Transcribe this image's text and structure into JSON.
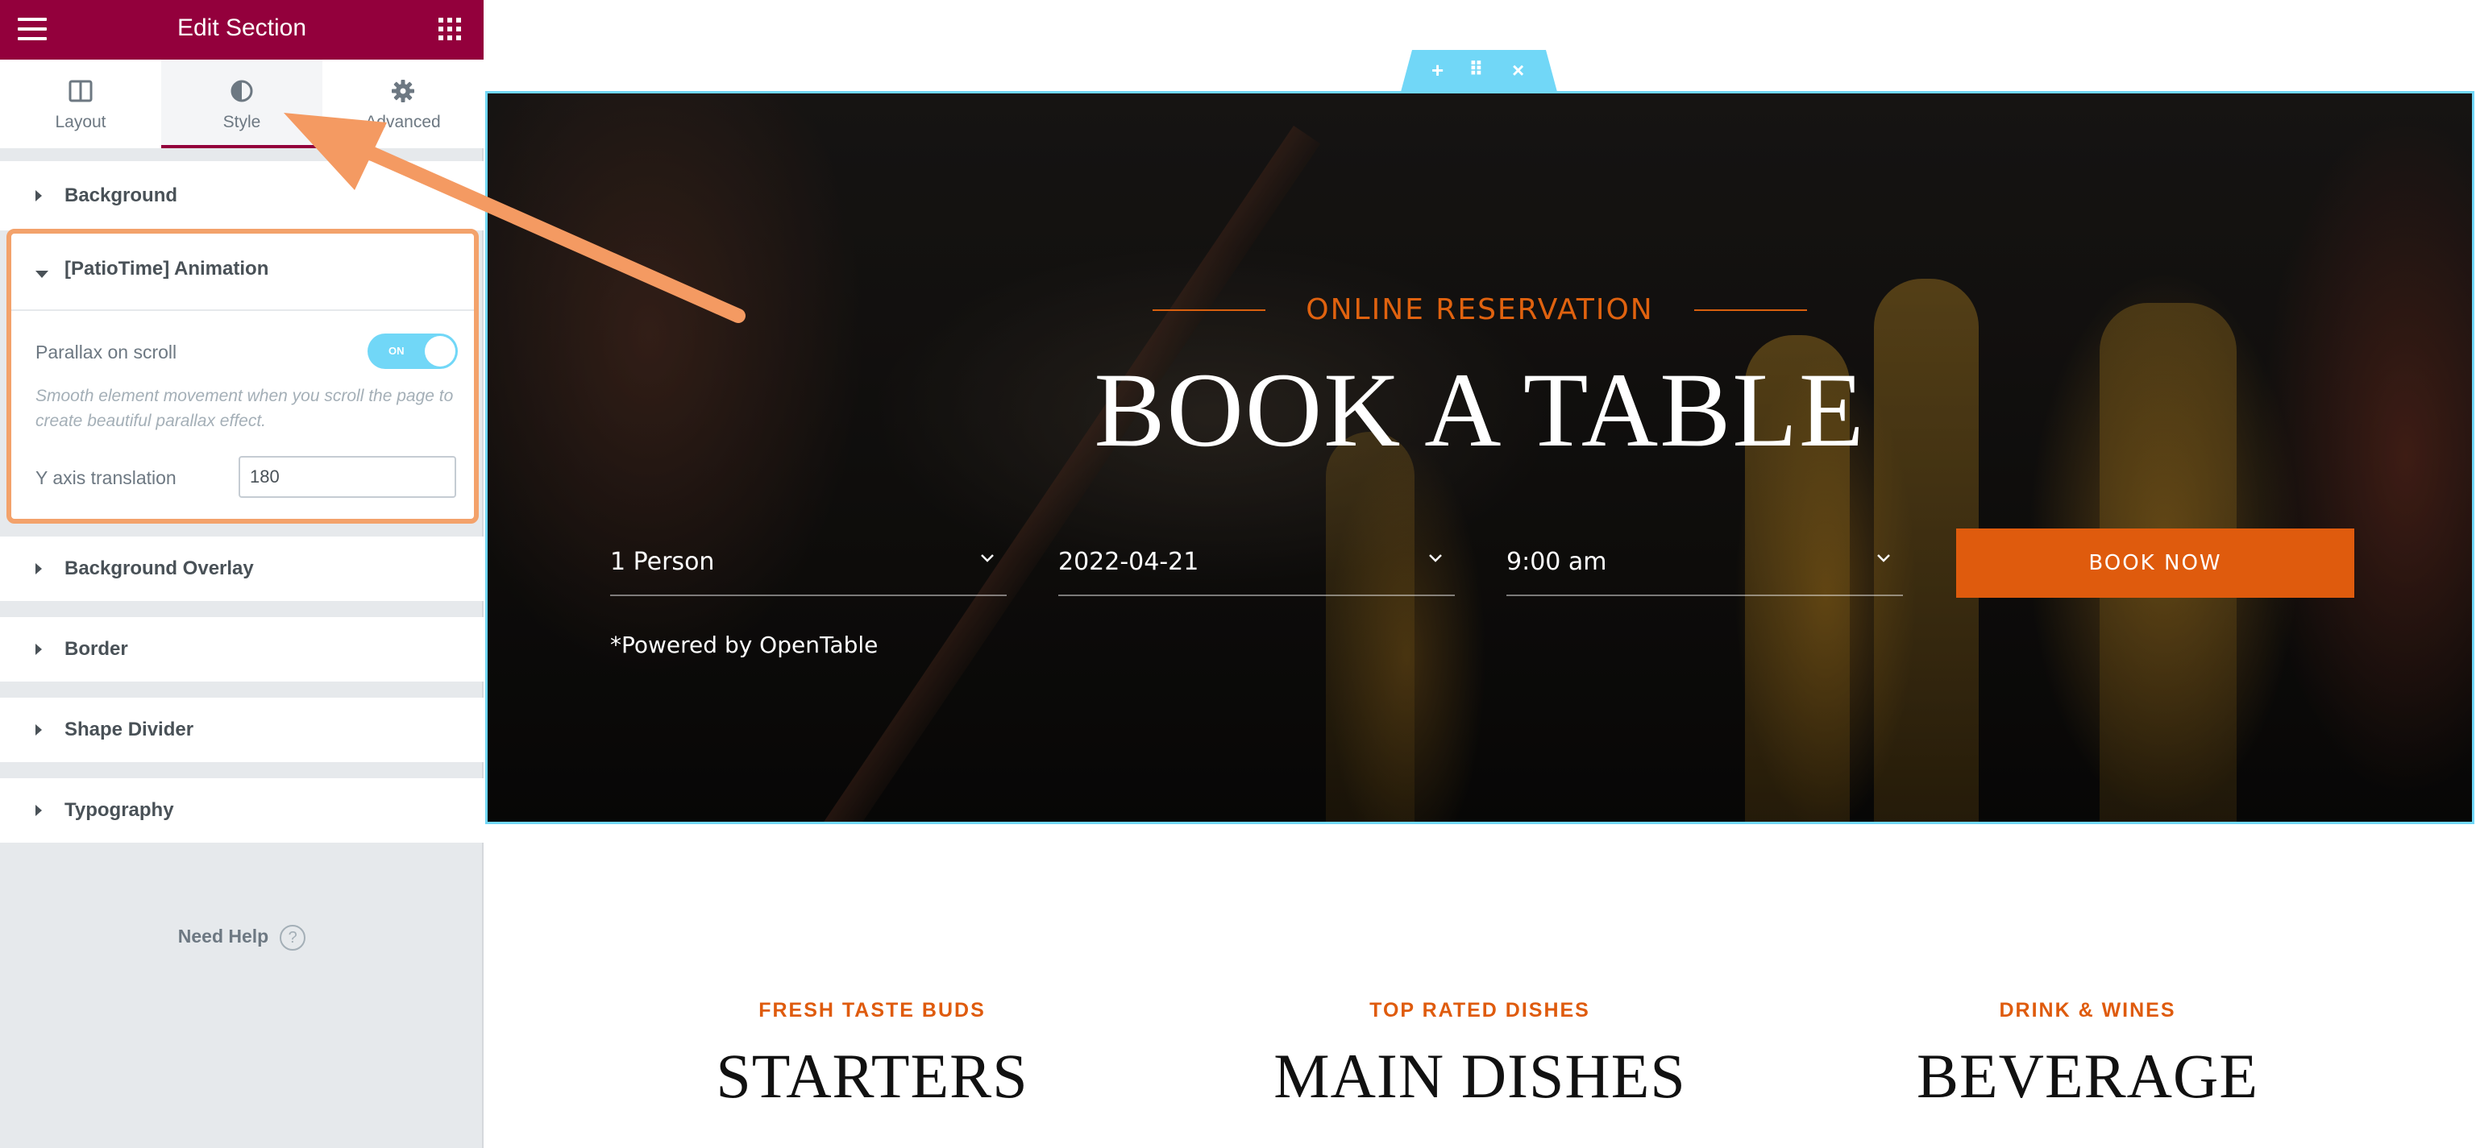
{
  "panel": {
    "title": "Edit Section",
    "tabs": [
      {
        "label": "Layout",
        "icon": "layout-columns-icon"
      },
      {
        "label": "Style",
        "icon": "contrast-circle-icon"
      },
      {
        "label": "Advanced",
        "icon": "gear-icon"
      }
    ],
    "sections": [
      {
        "label": "Background"
      },
      {
        "label": "[PatioTime] Animation"
      },
      {
        "label": "Background Overlay"
      },
      {
        "label": "Border"
      },
      {
        "label": "Shape Divider"
      },
      {
        "label": "Typography"
      }
    ],
    "animation": {
      "parallax_label": "Parallax on scroll",
      "toggle_text": "ON",
      "toggle_on": true,
      "description": "Smooth element movement when you scroll the page to create beautiful parallax effect.",
      "ytrans_label": "Y axis translation",
      "ytrans_value": "180"
    },
    "need_help": "Need Help",
    "help_icon": "?",
    "collapse_icon": "‹",
    "colors": {
      "header": "#93003c",
      "highlight": "#f3a26b",
      "toggle": "#71d7f7"
    }
  },
  "section_handle": {
    "add": "+",
    "move": "⠿",
    "close": "×"
  },
  "hero": {
    "subtitle": "ONLINE RESERVATION",
    "title": "BOOK A TABLE",
    "fields": [
      {
        "value": "1 Person"
      },
      {
        "value": "2022-04-21"
      },
      {
        "value": "9:00 am"
      }
    ],
    "button": "BOOK NOW",
    "powered": "*Powered by OpenTable",
    "accent": "#df5b0d"
  },
  "categories": [
    {
      "kicker": "FRESH TASTE BUDS",
      "heading": "STARTERS"
    },
    {
      "kicker": "TOP RATED DISHES",
      "heading": "MAIN DISHES"
    },
    {
      "kicker": "DRINK & WINES",
      "heading": "BEVERAGE"
    }
  ]
}
